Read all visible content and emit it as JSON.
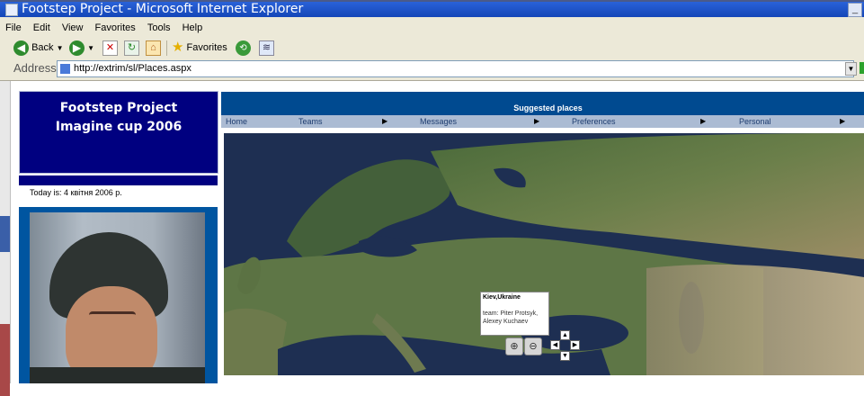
{
  "window": {
    "title": "Footstep Project - Microsoft Internet Explorer"
  },
  "menubar": [
    "File",
    "Edit",
    "View",
    "Favorites",
    "Tools",
    "Help"
  ],
  "toolbar": {
    "back_label": "Back",
    "favorites_label": "Favorites"
  },
  "address": {
    "label": "Address",
    "url": "http://extrim/sl/Places.aspx"
  },
  "sidebar": {
    "logo_line1": "Footstep Project",
    "logo_line2": "Imagine cup 2006",
    "today": "Today is: 4 квітня 2006 р."
  },
  "header": {
    "title": "Suggested places"
  },
  "nav": [
    {
      "label": "Home"
    },
    {
      "label": "Teams"
    },
    {
      "label": "Messages"
    },
    {
      "label": "Preferences"
    },
    {
      "label": "Personal"
    }
  ],
  "tooltip": {
    "place": "Kiev,Ukraine",
    "team": "team: Piter Protsyk, Alexey Kuchaev"
  },
  "colors": {
    "logo_bg": "#000080",
    "header_bg": "#004a90",
    "nav_bg": "#abbbd3"
  }
}
